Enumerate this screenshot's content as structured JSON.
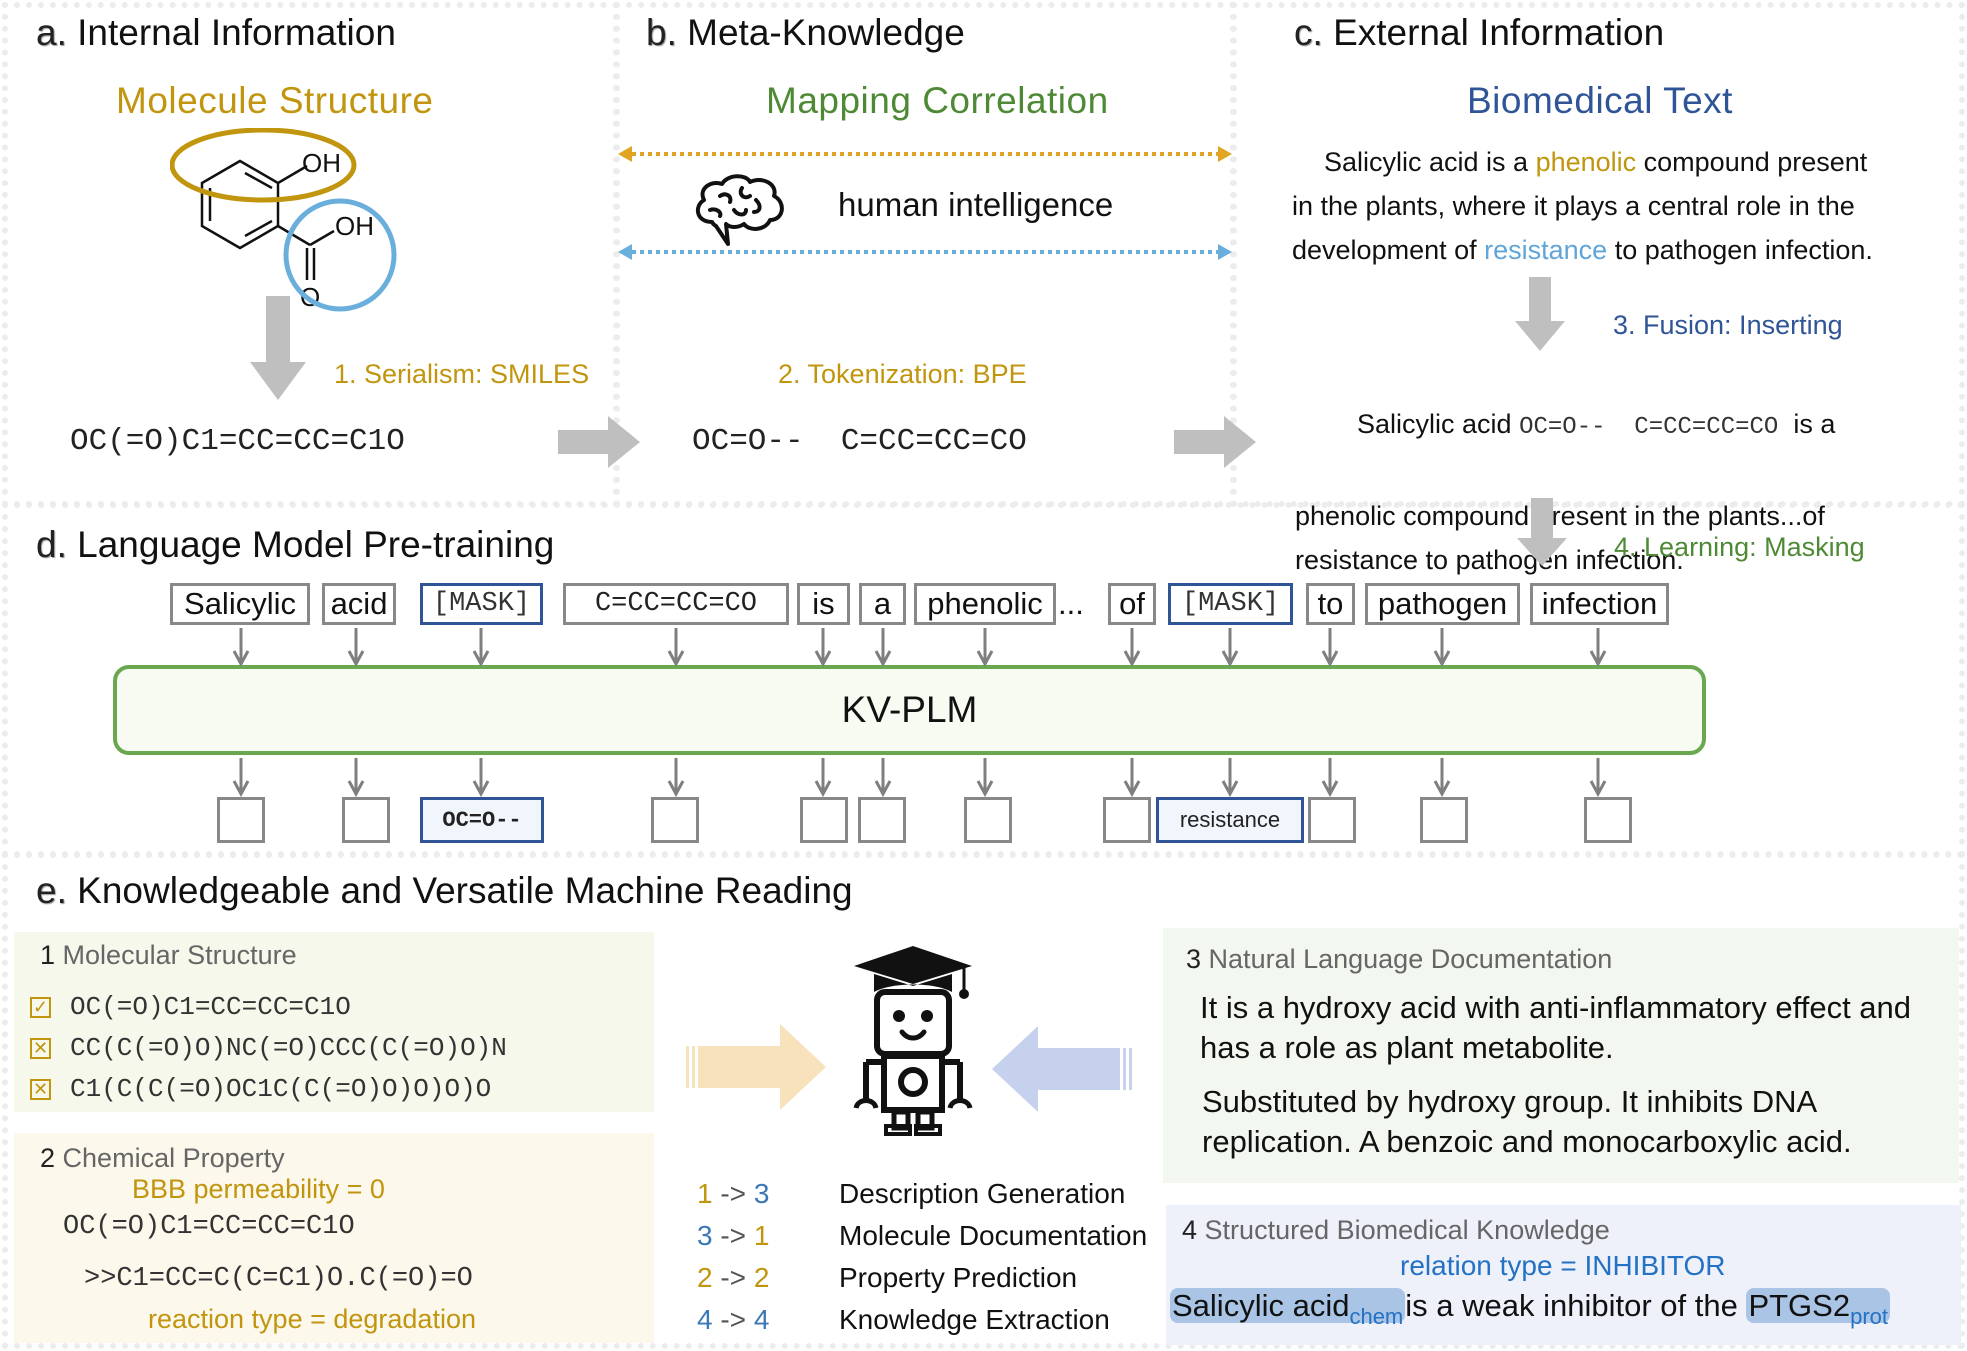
{
  "panel_a": {
    "letter": "a.",
    "title": "Internal Information",
    "subtitle": "Molecule Structure",
    "molecule_labels": {
      "oh_top": "OH",
      "oh_acid": "OH",
      "o_carbonyl": "O"
    },
    "step": "1. Serialism: SMILES",
    "smiles": "OC(=O)C1=CC=CC=C1O"
  },
  "panel_b": {
    "letter": "b.",
    "title": "Meta-Knowledge",
    "subtitle": "Mapping Correlation",
    "brain_caption": "human intelligence",
    "step": "2. Tokenization: BPE",
    "tokens": "OC=O--  C=CC=CC=CO"
  },
  "panel_c": {
    "letter": "c.",
    "title": "External Information",
    "subtitle": "Biomedical Text",
    "text_line1_pre": "Salicylic acid is a ",
    "text_highlight_gold": "phenolic",
    "text_line1_post": " compound present",
    "text_line2": "in the plants, where it plays a central role in the",
    "text_line3_pre": "development of ",
    "text_highlight_blue": "resistance",
    "text_line3_post": " to pathogen infection.",
    "step": "3. Fusion: Inserting",
    "fused_pre": "Salicylic acid ",
    "fused_tokens": "OC=O--  C=CC=CC=CO",
    "fused_post": "  is a",
    "fused_line2": "phenolic compound present in the plants...of",
    "fused_line3": "resistance to pathogen infection."
  },
  "panel_d": {
    "letter": "d.",
    "title": "Language Model Pre-training",
    "step": "4. Learning: Masking",
    "model_label": "KV-PLM",
    "ellipsis": "...",
    "input_tokens": [
      {
        "text": "Salicylic",
        "kind": "word"
      },
      {
        "text": "acid",
        "kind": "word"
      },
      {
        "text": "[MASK]",
        "kind": "mask"
      },
      {
        "text": "C=CC=CC=CO",
        "kind": "smiles"
      },
      {
        "text": "is",
        "kind": "word"
      },
      {
        "text": "a",
        "kind": "word"
      },
      {
        "text": "phenolic",
        "kind": "word"
      },
      {
        "text": "of",
        "kind": "word"
      },
      {
        "text": "[MASK]",
        "kind": "mask"
      },
      {
        "text": "to",
        "kind": "word"
      },
      {
        "text": "pathogen",
        "kind": "word"
      },
      {
        "text": "infection",
        "kind": "word"
      }
    ],
    "output_tokens": [
      "",
      "",
      "OC=O--",
      "",
      "",
      "",
      "",
      "",
      "resistance",
      "",
      "",
      ""
    ]
  },
  "panel_e": {
    "letter": "e.",
    "title": "Knowledgeable and Versatile Machine Reading",
    "box1": {
      "num": "1",
      "title": "Molecular Structure",
      "options": [
        {
          "state": "checked",
          "mark": "✓",
          "smiles": "OC(=O)C1=CC=CC=C1O"
        },
        {
          "state": "crossed",
          "mark": "✕",
          "smiles": "CC(C(=O)O)NC(=O)CCC(C(=O)O)N"
        },
        {
          "state": "crossed",
          "mark": "✕",
          "smiles": "C1(C(C(=O)OC1C(C(=O)O)O)O)O"
        }
      ]
    },
    "box2": {
      "num": "2",
      "title": "Chemical Property",
      "property": "BBB permeability = 0",
      "smiles": "OC(=O)C1=CC=CC=C1O",
      "product": ">>C1=CC=C(C=C1)O.C(=O)=O",
      "reaction": "reaction type = degradation"
    },
    "box3": {
      "num": "3",
      "title": "Natural Language Documentation",
      "para1": "It is a hydroxy acid with anti-inflammatory effect and has a role as plant metabolite.",
      "para2": "Substituted by hydroxy group. It inhibits DNA replication. A benzoic and monocarboxylic acid."
    },
    "box4": {
      "num": "4",
      "title": "Structured Biomedical Knowledge",
      "relation": "relation type = INHIBITOR",
      "entity1": "Salicylic acid",
      "entity1_type": "chem",
      "middle": "is a weak inhibitor of the ",
      "entity2": "PTGS2",
      "entity2_type": "prot"
    },
    "tasks": [
      {
        "from": "1",
        "from_color": "#C1950E",
        "to": "3",
        "to_color": "#3B78B5",
        "label": "Description Generation"
      },
      {
        "from": "3",
        "from_color": "#3B78B5",
        "to": "1",
        "to_color": "#C1950E",
        "label": "Molecule Documentation"
      },
      {
        "from": "2",
        "from_color": "#C1950E",
        "to": "2",
        "to_color": "#C1950E",
        "label": "Property Prediction"
      },
      {
        "from": "4",
        "from_color": "#3B78B5",
        "to": "4",
        "to_color": "#3B78B5",
        "label": "Knowledge Extraction"
      }
    ],
    "arrow_symbol": "->"
  },
  "colors": {
    "gold": "#C1950E",
    "green": "#4E8A35",
    "navy": "#2F5597",
    "light_blue": "#5FA5D9",
    "model_border": "#6AA84F",
    "box1_bg": "#F6F8EC",
    "box2_bg": "#FCF8EC",
    "box3_bg": "#F2F7EF",
    "box4_bg": "#EEF1FA"
  }
}
